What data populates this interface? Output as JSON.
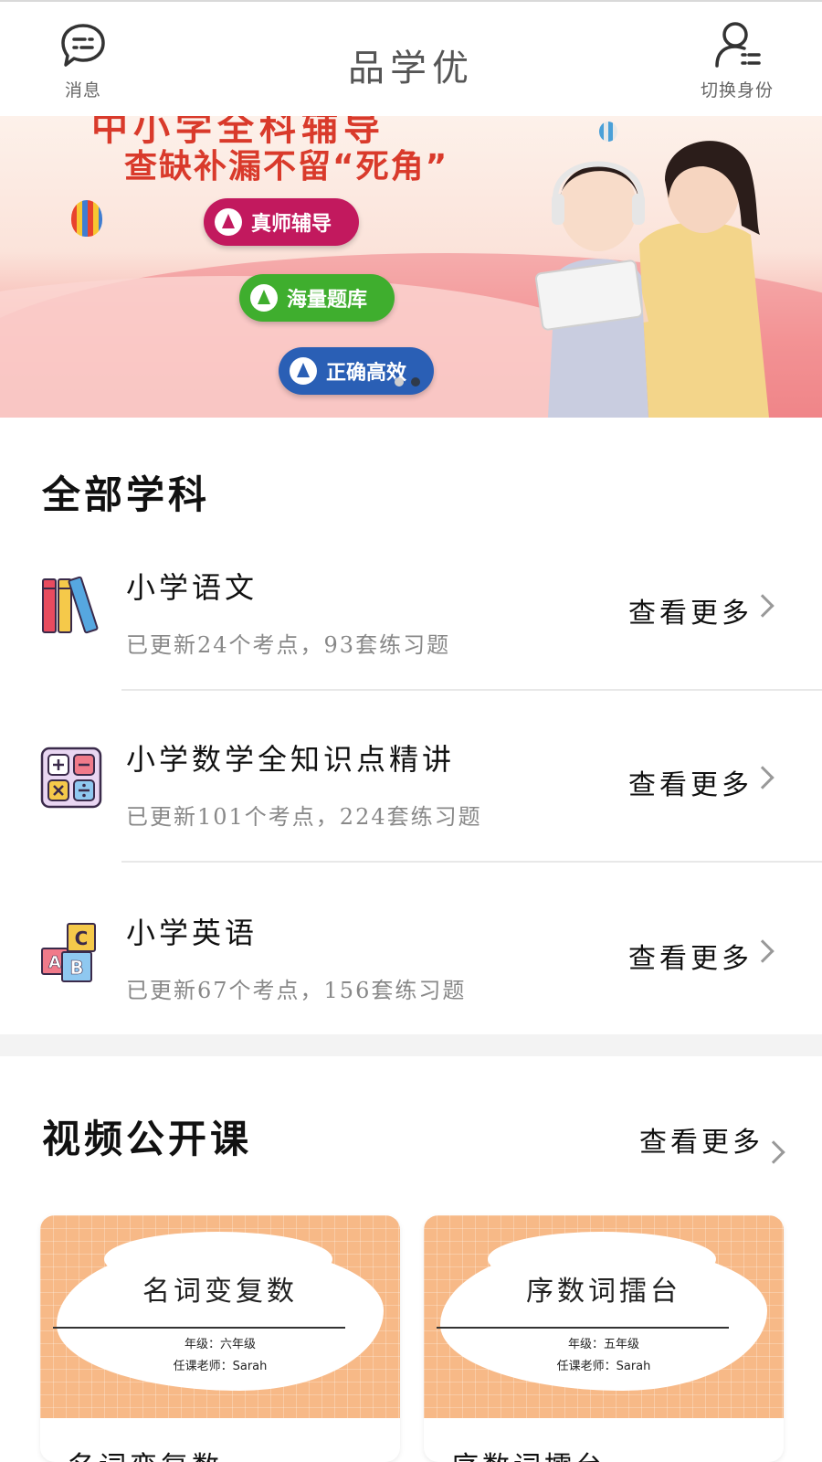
{
  "header": {
    "title": "品学优",
    "messages_label": "消息",
    "switch_identity_label": "切换身份"
  },
  "banner": {
    "top_text": "中小学全科辅导",
    "slogan": "查缺补漏不留“死角”",
    "pills": [
      "真师辅导",
      "海量题库",
      "正确高效"
    ],
    "page_count": 3,
    "active_page": 2
  },
  "subjects": {
    "title": "全部学科",
    "items": [
      {
        "name": "小学语文",
        "desc": "已更新24个考点，93套练习题",
        "more": "查看更多",
        "icon": "books-icon"
      },
      {
        "name": "小学数学全知识点精讲",
        "desc": "已更新101个考点，224套练习题",
        "more": "查看更多",
        "icon": "calculator-icon"
      },
      {
        "name": "小学英语",
        "desc": "已更新67个考点，156套练习题",
        "more": "查看更多",
        "icon": "abc-blocks-icon"
      }
    ]
  },
  "videos": {
    "title": "视频公开课",
    "more": "查看更多",
    "cards": [
      {
        "title": "名词变复数",
        "grade": "年级：六年级",
        "teacher": "任课老师：Sarah",
        "caption": "名词变复数"
      },
      {
        "title": "序数词擂台",
        "grade": "年级：五年级",
        "teacher": "任课老师：Sarah",
        "caption": "序数词擂台"
      }
    ]
  },
  "colors": {
    "accent_red": "#d93a2b",
    "pill_magenta": "#c2195e",
    "pill_green": "#3fae2e",
    "pill_blue": "#2a5fb5",
    "thumb_orange": "#f7b987"
  }
}
